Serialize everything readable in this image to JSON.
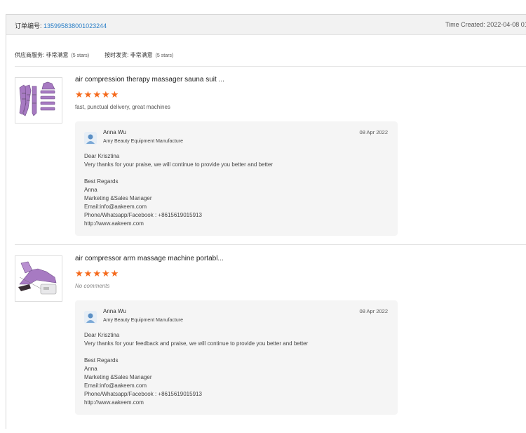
{
  "order": {
    "label": "订单编号:",
    "number": "135995838001023244",
    "time_created": "Time Created: 2022-04-08 01"
  },
  "store_ratings": {
    "supplier_label": "供应商服务: 非常满意",
    "supplier_stars": "(5 stars)",
    "shipping_label": "按时发货: 非常满意",
    "shipping_stars": "(5 stars)"
  },
  "reviews": [
    {
      "product_title": "air compression therapy massager sauna suit ...",
      "rating": 5,
      "comment": "fast, punctual delivery, great machines",
      "reply": {
        "seller_name": "Anna Wu",
        "seller_company": "Amy Beauty Equipment Manufacture",
        "date": "08 Apr 2022",
        "lines": [
          "Dear Krisztina",
          "Very thanks for your praise, we will continue to provide you better and better",
          "",
          "Best Regards",
          "Anna",
          "Marketing &Sales Manager",
          "Email:info@aakeem.com",
          "Phone/Whatsapp/Facebook : +8615619015913",
          "http://www.aakeem.com"
        ]
      }
    },
    {
      "product_title": "air compressor arm massage machine portabl...",
      "rating": 5,
      "comment": "No comments",
      "reply": {
        "seller_name": "Anna Wu",
        "seller_company": "Amy Beauty Equipment Manufacture",
        "date": "08 Apr 2022",
        "lines": [
          "Dear Krisztina",
          "Very thanks for your feedback and praise, we will continue to provide you better and better",
          "",
          "Best Regards",
          "Anna",
          "Marketing &Sales Manager",
          "Email:info@aakeem.com",
          "Phone/Whatsapp/Facebook : +8615619015913",
          "http://www.aakeem.com"
        ]
      }
    }
  ],
  "colors": {
    "star": "#f56a1c",
    "link": "#2b7fc7",
    "reply_bg": "#f5f5f5"
  }
}
